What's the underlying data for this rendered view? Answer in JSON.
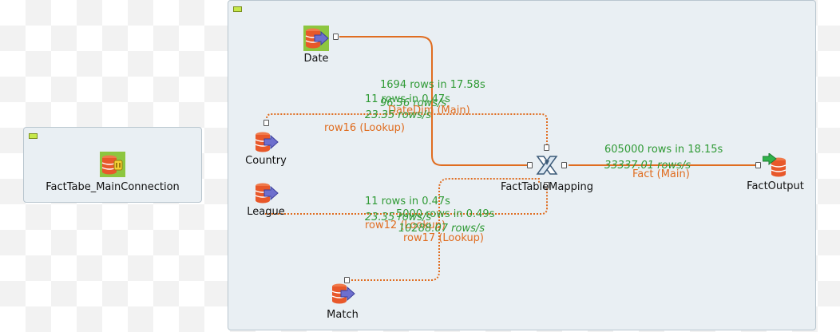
{
  "colors": {
    "main_link": "#e06d20",
    "stats_text": "#2f9a35",
    "subjob_bg": "#e9eff3",
    "db_orange": "#e8582a",
    "arrow_purple": "#6d6fce",
    "arrow_green": "#2fb24a"
  },
  "subjobs": {
    "connection": {
      "component": {
        "label": "FactTabe_MainConnection",
        "icon": "database-connection-icon"
      }
    }
  },
  "components": {
    "date": {
      "label": "Date",
      "icon": "database-input-icon"
    },
    "country": {
      "label": "Country",
      "icon": "database-input-icon"
    },
    "league": {
      "label": "League",
      "icon": "database-input-icon"
    },
    "match": {
      "label": "Match",
      "icon": "database-input-icon"
    },
    "mapping": {
      "label": "FactTableMapping",
      "icon": "tmap-cross-icon"
    },
    "output": {
      "label": "FactOutput",
      "icon": "database-output-icon"
    }
  },
  "connections": {
    "datedim": {
      "stat1": "1694 rows in 17.58s",
      "stat2": "96.36 rows/s",
      "label": "DateDim (Main)"
    },
    "row16": {
      "stat1": "11 rows in 0.47s",
      "stat2": "23.35 rows/s",
      "label": "row16 (Lookup)"
    },
    "row12": {
      "stat1": "11 rows in 0.47s",
      "stat2": "23.35 rows/s",
      "label": "row12 (Lookup)"
    },
    "row17": {
      "stat1": "5000 rows in 0.49s",
      "stat2": "10288.07 rows/s",
      "label": "row17 (Lookup)"
    },
    "fact": {
      "stat1": "605000 rows in 18.15s",
      "stat2": "33337.01 rows/s",
      "label": "Fact (Main)"
    }
  }
}
